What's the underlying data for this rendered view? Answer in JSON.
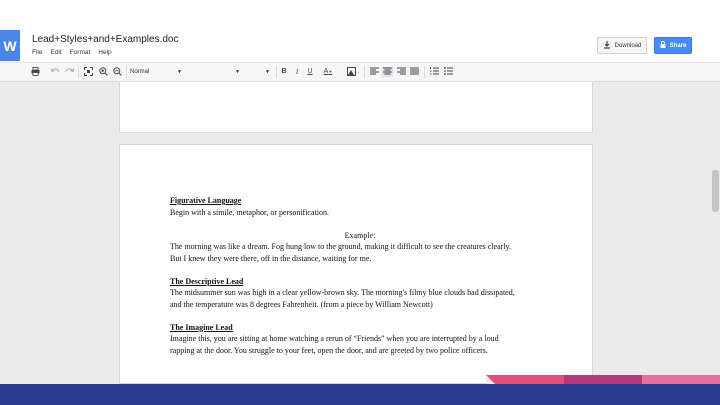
{
  "app": {
    "logo_letter": "W"
  },
  "document": {
    "title": "Lead+Styles+and+Examples.doc"
  },
  "menu": [
    "File",
    "Edit",
    "Format",
    "Help"
  ],
  "actions": {
    "download_label": "Download",
    "share_label": "Share"
  },
  "toolbar": {
    "style_value": "Normal",
    "bold": "B",
    "italic": "I",
    "underline": "U",
    "text_color": "A",
    "icons": [
      "print-icon",
      "undo-icon",
      "redo-icon",
      "fit-icon",
      "zoom-in-icon",
      "zoom-out-icon",
      "align-left-icon",
      "align-center-icon",
      "align-right-icon",
      "justify-icon",
      "numbered-list-icon",
      "bulleted-list-icon"
    ]
  },
  "content": {
    "s1_heading": "Figurative Language",
    "s1_line1": "Begin with a simile, metaphor, or personification.",
    "example_label": "Example:",
    "ex_line1": "The morning was like a dream.  Fog hung low to the ground, making it difficult to see the creatures clearly.",
    "ex_line2": "But I knew they were there, off in the distance, waiting for me.",
    "s2_heading": "The Descriptive Lead",
    "s2_line1": "The midsummer sun was high in a clear yellow-brown sky.  The morning's filmy blue clouds had dissipated,",
    "s2_line2": "and the temperature was 8 degrees Fahrenheit. (from a piece by William Newcott)",
    "s3_heading": "The Imagine Lead",
    "s3_line1": "Imagine this, you are sitting at home watching a rerun of “Friends” when you are interrupted by a loud",
    "s3_line2": "rapping at the door.  You struggle to your feet, open the door, and are greeted by two police officers."
  },
  "colors": {
    "accent": "#4a8af4",
    "footer": "#2a3a8c",
    "stripe_pink": "#e0507e",
    "stripe_magenta": "#b13a7d"
  }
}
